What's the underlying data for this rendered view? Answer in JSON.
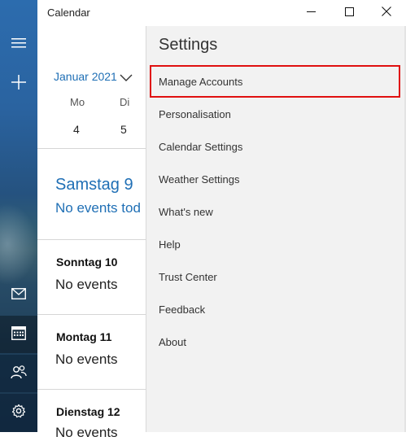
{
  "window": {
    "title": "Calendar",
    "controls": {
      "minimize": "minimize",
      "maximize": "maximize",
      "close": "close"
    }
  },
  "rail": {
    "icons": [
      "hamburger-icon",
      "plus-icon",
      "mail-icon",
      "calendar-icon",
      "people-icon",
      "gear-icon"
    ]
  },
  "calendar": {
    "month_label": "Januar 2021",
    "weekdays": [
      "Mo",
      "Di"
    ],
    "day_numbers": [
      "4",
      "5"
    ],
    "agenda": [
      {
        "day": "Samstag 9",
        "events": "No events tod"
      },
      {
        "day": "Sonntag 10",
        "events": "No events"
      },
      {
        "day": "Montag 11",
        "events": "No events"
      },
      {
        "day": "Dienstag 12",
        "events": "No events"
      }
    ]
  },
  "settings": {
    "title": "Settings",
    "items": [
      "Manage Accounts",
      "Personalisation",
      "Calendar Settings",
      "Weather Settings",
      "What's new",
      "Help",
      "Trust Center",
      "Feedback",
      "About"
    ],
    "highlighted_item": "Manage Accounts"
  },
  "colors": {
    "accent": "#1f6fb5",
    "highlight_border": "#e01010",
    "flyout_bg": "#f2f2f2"
  }
}
